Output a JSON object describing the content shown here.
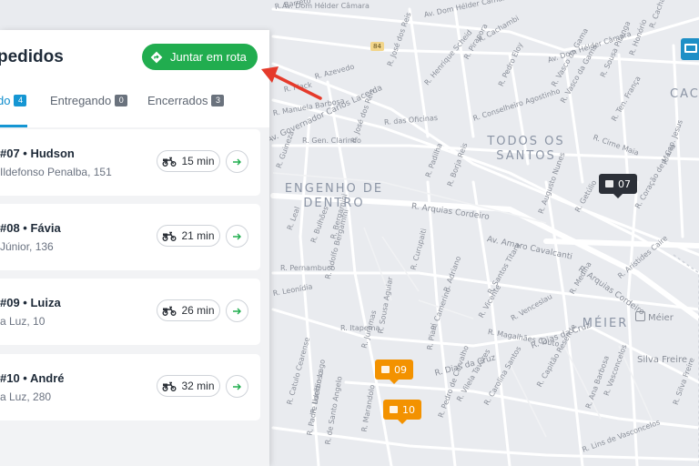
{
  "panel": {
    "title": "pedidos",
    "route_button": "Juntar em rota",
    "tabs": [
      {
        "label": "do",
        "count": "4"
      },
      {
        "label": "Entregando",
        "count": "0"
      },
      {
        "label": "Encerrados",
        "count": "3"
      }
    ],
    "orders": [
      {
        "name": "#07 • Hudson",
        "address": "Ildefonso Penalba, 151",
        "eta": "15 min"
      },
      {
        "name": "#08 • Fávia",
        "address": "Júnior, 136",
        "eta": "21 min"
      },
      {
        "name": "#09 • Luiza",
        "address": "a Luz, 10",
        "eta": "26 min"
      },
      {
        "name": "#10 • André",
        "address": "a Luz, 280",
        "eta": "32 min"
      }
    ]
  },
  "map": {
    "districts": [
      "TODOS OS SANTOS",
      "ENGENHO DE DENTRO",
      "MÉIER",
      "CAC"
    ],
    "road_badge": "84",
    "pins": [
      {
        "label": "07",
        "style": "dark"
      },
      {
        "label": "09",
        "style": "orange"
      },
      {
        "label": "10",
        "style": "orange"
      }
    ],
    "streets": [
      "R. Barreto",
      "Av. Dom Hélder Câmara",
      "Av. Dom Hélder Câmara",
      "Av. Dom Hélder Câmara",
      "R. Cachambi",
      "R. Honório",
      "R. Sousa Pitanga",
      "R. Vasco da Gama",
      "R. Vasco da Gama",
      "R. Ten. França",
      "R. Cirne Maia",
      "R. Cap. Jesus",
      "R. Coração de Maria",
      "R. Getúlio",
      "R. Aristides Caire",
      "R. Medina",
      "R. Arquias Cordeiro",
      "R. Arquias Cordeiro",
      "Av. Amaro Cavalcanti",
      "R. Conselheiro Agostinho",
      "R. das Oficinas",
      "R. José dos Reis",
      "R. José dos Reis",
      "R. Henrique Scheid",
      "R. Gen. Clarindo",
      "R. Guineza",
      "Av. Governador Carlos Lacerda",
      "R. Manuela Barbosa",
      "R. Flack",
      "R. Azevedo",
      "R. Padilha",
      "R. Augusto Nunes",
      "R. Borja Reis",
      "R. Leal",
      "R. Bulhões",
      "R. Bergamini",
      "R. Adolfo Bergamini",
      "R. Pernambuco",
      "R. Leonídia",
      "R. Itapema",
      "R. Juramas",
      "R. Sousa Aguiar",
      "R. Curupaiti",
      "R. Adriano",
      "R. Santos Titara",
      "R. Vicente",
      "R. Venceslau",
      "R. Magalhães Couto",
      "R. Dias da Cruz",
      "R. Dias da Cruz",
      "R. Capitão Resende",
      "R. Piauí",
      "R. Pedro de Carvalho",
      "R. Vilela Tavares",
      "R. Carolina Santos",
      "R. Lins de Vasconcelos",
      "R. Camerino",
      "R. Marandolo",
      "R. Catulo Cearense",
      "R. Lucídio Lago",
      "R. Padre Ildefonso",
      "R. de Santo Angelo",
      "Méier",
      "Silva Freire",
      "R. Silva Freire",
      "R. Vasconcelos",
      "R. Ana Barbosa",
      "R. Pirapora",
      "R. Cachambi",
      "R. Pedro Eloy"
    ]
  },
  "colors": {
    "accent": "#1596d3",
    "route_green": "#21ad4f",
    "pin_orange": "#f39200",
    "pin_dark": "#2c3038",
    "arrow_red": "#e53a2b"
  },
  "icons": {
    "route": "diamond-turn-icon",
    "eta": "scooter-icon",
    "go": "arrow-right-icon",
    "pin": "package-icon"
  }
}
